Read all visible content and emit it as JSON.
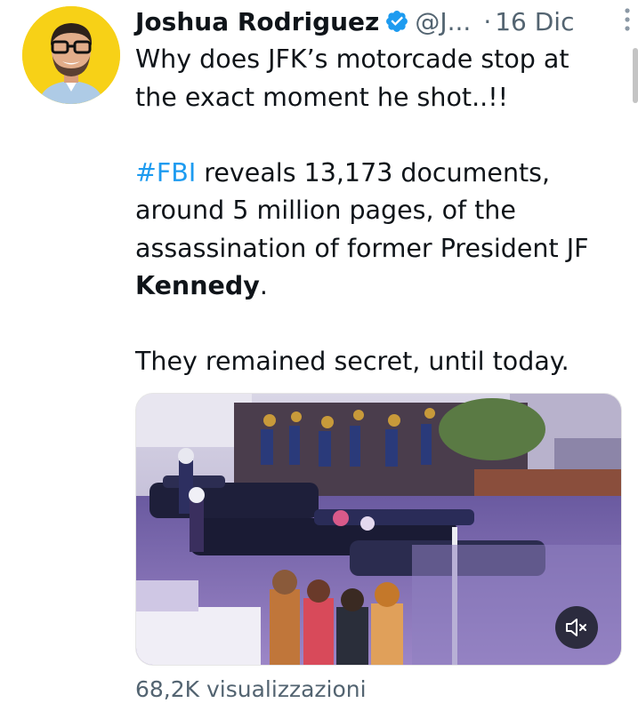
{
  "tweet": {
    "author_name": "Joshua Rodriguez",
    "handle": "@J...",
    "separator": "·",
    "date": "16 Dic",
    "text": {
      "line1": "Why does JFK’s motorcade stop at",
      "line2": "the exact moment he shot..!!",
      "hashtag": "#FBI",
      "line3_rest": " reveals 13,173 documents,",
      "line4": "around 5 million pages, of the",
      "line5": "assassination of former President JF",
      "bold_word": "Kennedy",
      "line6_rest": ".",
      "line7": "They remained secret, until today."
    },
    "views": "68,2K visualizzazioni"
  },
  "icons": {
    "verified": "verified-badge-icon",
    "more": "more-vertical-icon",
    "mute": "volume-muted-icon"
  },
  "colors": {
    "hashtag": "#1d9bf0",
    "verified": "#1d9bf0",
    "secondary_text": "#536471",
    "avatar_bg": "#f7d117"
  }
}
